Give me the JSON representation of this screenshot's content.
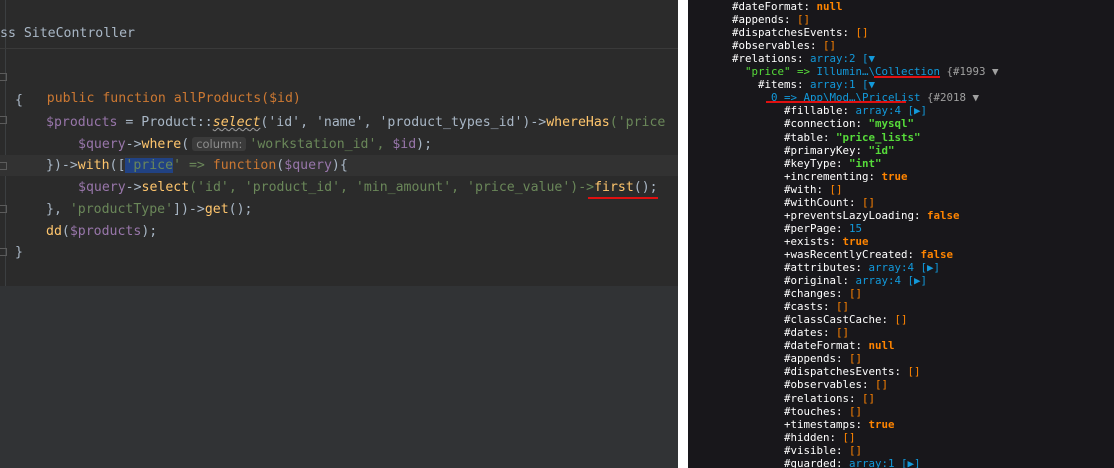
{
  "editor": {
    "class_header": "ss SiteController",
    "lines": {
      "l1": "public function allProducts($id)",
      "l2": "{",
      "l3_var": "$products",
      "l3_a": " = Product::",
      "l3_select": "select",
      "l3_b": "('id', 'name', 'product_types_id')->",
      "l3_wh": "whereHas",
      "l3_c": "('price",
      "l4_var": "$query",
      "l4_a": "->",
      "l4_where": "where",
      "l4_hint": "column:",
      "l4_b": "'workstation_id', ",
      "l4_var2": "$id",
      "l4_c": ");",
      "l5_a": "})->",
      "l5_with": "with",
      "l5_b": "([",
      "l5_price": "'price",
      "l5_c": "' => ",
      "l5_fn": "function",
      "l5_d": "(",
      "l5_var": "$query",
      "l5_e": "){",
      "l6_var": "$query",
      "l6_a": "->",
      "l6_select": "select",
      "l6_b": "('id', 'product_id', 'min_amount', 'price_value')->",
      "l6_first": "first",
      "l6_c": "();",
      "l7_a": "}, ",
      "l7_str": "'productType'",
      "l7_b": "])->",
      "l7_get": "get",
      "l7_c": "();",
      "l8_dd": "dd",
      "l8_a": "(",
      "l8_var": "$products",
      "l8_b": ");",
      "l9": "}"
    }
  },
  "dump": {
    "lines": [
      [
        "#dateFormat",
        ": ",
        "null",
        "og"
      ],
      [
        "#appends",
        ": ",
        "[]",
        "brk"
      ],
      [
        "#dispatchesEvents",
        ": ",
        "[]",
        "brk"
      ],
      [
        "#observables",
        ": ",
        "[]",
        "brk"
      ],
      [
        "#relations",
        ": ",
        "array:2 [▼",
        "bl"
      ],
      [
        "\"price\" => ",
        "Illumin…\\Collection",
        " {#1993 ▼",
        "col"
      ],
      [
        "#items",
        ": ",
        "array:1 [▼",
        "bl"
      ],
      [
        "0 => ",
        "App\\Mod…\\PriceList",
        " {#2018 ▼",
        "item"
      ],
      [
        "#fillable",
        ": ",
        "array:4 [▶]",
        "bl"
      ],
      [
        "#connection",
        ": ",
        "\"mysql\"",
        "gn"
      ],
      [
        "#table",
        ": ",
        "\"price_lists\"",
        "gn"
      ],
      [
        "#primaryKey",
        ": ",
        "\"id\"",
        "gn"
      ],
      [
        "#keyType",
        ": ",
        "\"int\"",
        "gn"
      ],
      [
        "+incrementing",
        ": ",
        "true",
        "og"
      ],
      [
        "#with",
        ": ",
        "[]",
        "brk"
      ],
      [
        "#withCount",
        ": ",
        "[]",
        "brk"
      ],
      [
        "+preventsLazyLoading",
        ": ",
        "false",
        "og"
      ],
      [
        "#perPage",
        ": ",
        "15",
        "bl"
      ],
      [
        "+exists",
        ": ",
        "true",
        "og"
      ],
      [
        "+wasRecentlyCreated",
        ": ",
        "false",
        "og"
      ],
      [
        "#attributes",
        ": ",
        "array:4 [▶]",
        "bl"
      ],
      [
        "#original",
        ": ",
        "array:4 [▶]",
        "bl"
      ],
      [
        "#changes",
        ": ",
        "[]",
        "brk"
      ],
      [
        "#casts",
        ": ",
        "[]",
        "brk"
      ],
      [
        "#classCastCache",
        ": ",
        "[]",
        "brk"
      ],
      [
        "#dates",
        ": ",
        "[]",
        "brk"
      ],
      [
        "#dateFormat",
        ": ",
        "null",
        "og"
      ],
      [
        "#appends",
        ": ",
        "[]",
        "brk"
      ],
      [
        "#dispatchesEvents",
        ": ",
        "[]",
        "brk"
      ],
      [
        "#observables",
        ": ",
        "[]",
        "brk"
      ],
      [
        "#relations",
        ": ",
        "[]",
        "brk"
      ],
      [
        "#touches",
        ": ",
        "[]",
        "brk"
      ],
      [
        "+timestamps",
        ": ",
        "true",
        "og"
      ],
      [
        "#hidden",
        ": ",
        "[]",
        "brk"
      ],
      [
        "#visible",
        ": ",
        "[]",
        "brk"
      ],
      [
        "#guarded",
        ": ",
        "array:1 [▶]",
        "bl"
      ]
    ]
  },
  "colors": {
    "ide_bg": "#2b2b2b",
    "dump_bg": "#18171b",
    "annotation_red": "#e01010"
  }
}
